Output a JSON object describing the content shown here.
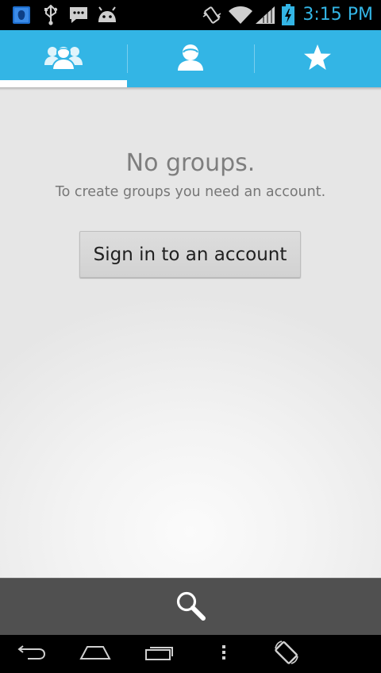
{
  "status_bar": {
    "time": "3:15 PM",
    "accent_color": "#33b5e5",
    "icons": [
      "app-notification-icon",
      "usb-icon",
      "chat-icon",
      "android-debug-icon",
      "vibrate-icon",
      "wifi-icon",
      "signal-icon",
      "battery-charging-icon"
    ]
  },
  "tabs": [
    {
      "name": "groups",
      "icon": "groups-icon",
      "selected": true
    },
    {
      "name": "contacts",
      "icon": "person-icon",
      "selected": false
    },
    {
      "name": "favorites",
      "icon": "star-icon",
      "selected": false
    }
  ],
  "colors": {
    "tab_bar": "#33b5e5",
    "bottom_bar": "#505050"
  },
  "empty_state": {
    "title": "No groups.",
    "message": "To create groups you need an account.",
    "button_label": "Sign in to an account"
  },
  "bottom_bar": {
    "actions": [
      "search-icon"
    ]
  },
  "nav_bar": {
    "buttons": [
      "back-icon",
      "home-icon",
      "recent-apps-icon",
      "menu-icon",
      "rotate-icon"
    ]
  }
}
